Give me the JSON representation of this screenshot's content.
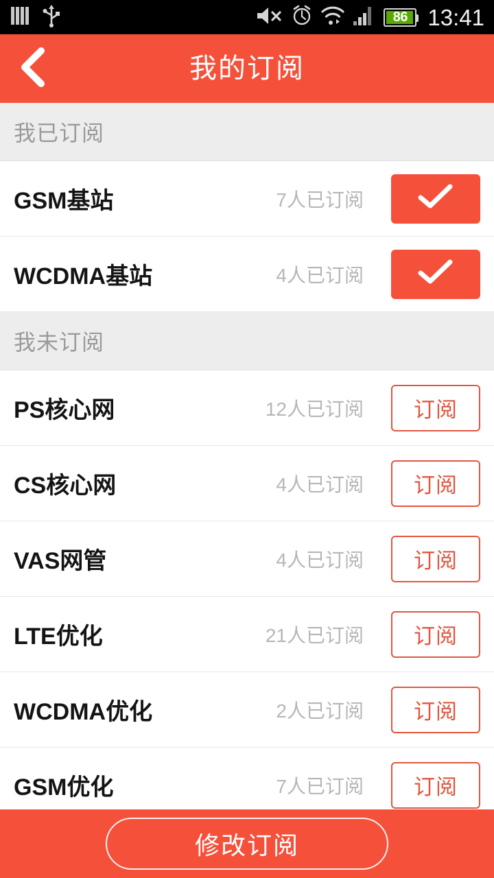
{
  "statusbar": {
    "time": "13:41",
    "battery_level": "86",
    "icons": [
      "signal-bars-icon",
      "usb-icon",
      "mute-icon",
      "alarm-clock-icon",
      "wifi-icon",
      "cell-signal-icon",
      "battery-icon"
    ],
    "battery_color": "#5aa803"
  },
  "header": {
    "title": "我的订阅",
    "back_icon": "back-chevron-icon",
    "background": "#f4503a"
  },
  "sections": [
    {
      "label": "我已订阅",
      "rows": [
        {
          "title": "GSM基站",
          "count": "7人已订阅",
          "subscribed": true,
          "button_icon": "check-icon"
        },
        {
          "title": "WCDMA基站",
          "count": "4人已订阅",
          "subscribed": true,
          "button_icon": "check-icon"
        }
      ]
    },
    {
      "label": "我未订阅",
      "rows": [
        {
          "title": "PS核心网",
          "count": "12人已订阅",
          "subscribed": false,
          "button_label": "订阅"
        },
        {
          "title": "CS核心网",
          "count": "4人已订阅",
          "subscribed": false,
          "button_label": "订阅"
        },
        {
          "title": "VAS网管",
          "count": "4人已订阅",
          "subscribed": false,
          "button_label": "订阅"
        },
        {
          "title": "LTE优化",
          "count": "21人已订阅",
          "subscribed": false,
          "button_label": "订阅"
        },
        {
          "title": "WCDMA优化",
          "count": "2人已订阅",
          "subscribed": false,
          "button_label": "订阅"
        },
        {
          "title": "GSM优化",
          "count": "7人已订阅",
          "subscribed": false,
          "button_label": "订阅"
        }
      ]
    }
  ],
  "bottombar": {
    "modify_label": "修改订阅"
  },
  "colors": {
    "accent": "#f4503a",
    "section_bg": "#ededed",
    "count_text": "#b6b6b6",
    "outline_btn": "#e2553f"
  }
}
